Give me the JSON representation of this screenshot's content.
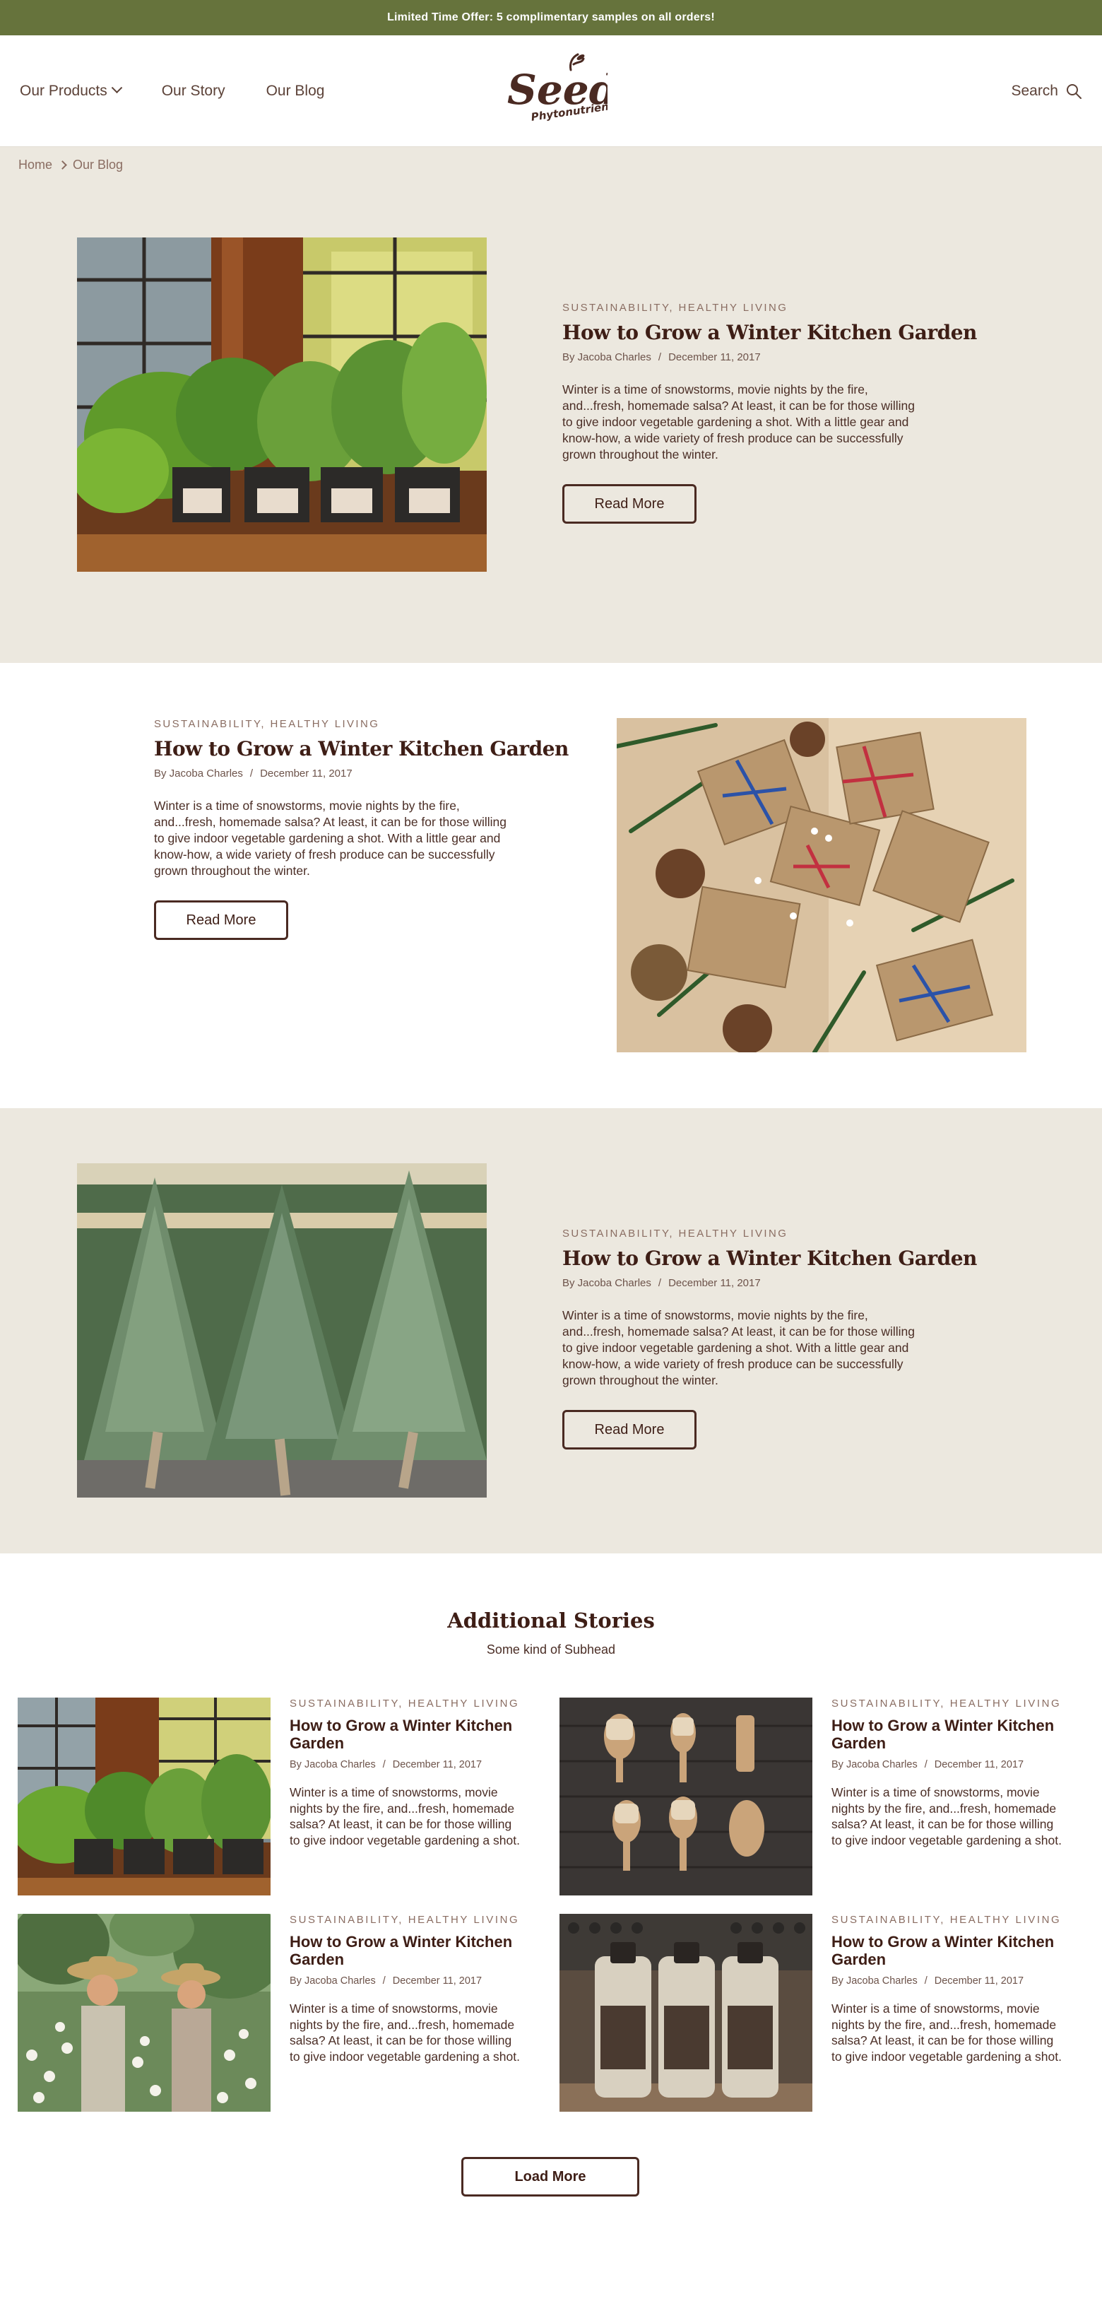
{
  "promo": {
    "text": "Limited Time Offer: 5 complimentary samples on all orders!"
  },
  "header": {
    "nav": [
      {
        "label": "Our Products",
        "has_dropdown": true
      },
      {
        "label": "Our Story"
      },
      {
        "label": "Our Blog"
      }
    ],
    "logo": {
      "main": "Seed",
      "sub": "Phytonutrients"
    },
    "search_label": "Search"
  },
  "breadcrumb": [
    "Home",
    "Our Blog"
  ],
  "features": [
    {
      "categories": "SUSTAINABILITY, HEALTHY LIVING",
      "title": "How to Grow a Winter Kitchen Garden",
      "author": "By Jacoba Charles",
      "separator": "/",
      "date": "December 11, 2017",
      "excerpt": "Winter is a time of snowstorms, movie nights by the fire, and...fresh, homemade salsa? At least, it can be for those willing to give indoor vegetable gardening a shot. With a little gear and know-how, a wide variety of fresh produce can be successfully grown throughout the winter.",
      "button": "Read More",
      "image": "herb-pots-window"
    },
    {
      "categories": "SUSTAINABILITY, HEALTHY LIVING",
      "title": "How to Grow a Winter Kitchen Garden",
      "author": "By Jacoba Charles",
      "separator": "/",
      "date": "December 11, 2017",
      "excerpt": "Winter is a time of snowstorms, movie nights by the fire, and...fresh, homemade salsa? At least, it can be for those willing to give indoor vegetable gardening a shot. With a little gear and know-how, a wide variety of fresh produce can be successfully grown throughout the winter.",
      "button": "Read More",
      "image": "wrapped-gifts-pine"
    },
    {
      "categories": "SUSTAINABILITY, HEALTHY LIVING",
      "title": "How to Grow a Winter Kitchen Garden",
      "author": "By Jacoba Charles",
      "separator": "/",
      "date": "December 11, 2017",
      "excerpt": "Winter is a time of snowstorms, movie nights by the fire, and...fresh, homemade salsa? At least, it can be for those willing to give indoor vegetable gardening a shot. With a little gear and know-how, a wide variety of fresh produce can be successfully grown throughout the winter.",
      "button": "Read More",
      "image": "christmas-trees"
    }
  ],
  "additional": {
    "title": "Additional Stories",
    "subhead": "Some kind of Subhead",
    "cards": [
      {
        "categories": "SUSTAINABILITY, HEALTHY LIVING",
        "title": "How to Grow a Winter Kitchen Garden",
        "author": "By Jacoba Charles",
        "separator": "/",
        "date": "December 11, 2017",
        "excerpt": "Winter is a time of snowstorms, movie nights by the fire, and...fresh, homemade salsa? At least, it can be for those willing to give indoor vegetable gardening a shot.",
        "image": "herb-pots-window"
      },
      {
        "categories": "SUSTAINABILITY, HEALTHY LIVING",
        "title": "How to Grow a Winter Kitchen Garden",
        "author": "By Jacoba Charles",
        "separator": "/",
        "date": "December 11, 2017",
        "excerpt": "Winter is a time of snowstorms, movie nights by the fire, and...fresh, homemade salsa? At least, it can be for those willing to give indoor vegetable gardening a shot.",
        "image": "wooden-brushes"
      },
      {
        "categories": "SUSTAINABILITY, HEALTHY LIVING",
        "title": "How to Grow a Winter Kitchen Garden",
        "author": "By Jacoba Charles",
        "separator": "/",
        "date": "December 11, 2017",
        "excerpt": "Winter is a time of snowstorms, movie nights by the fire, and...fresh, homemade salsa? At least, it can be for those willing to give indoor vegetable gardening a shot.",
        "image": "farmers-in-flower-field"
      },
      {
        "categories": "SUSTAINABILITY, HEALTHY LIVING",
        "title": "How to Grow a Winter Kitchen Garden",
        "author": "By Jacoba Charles",
        "separator": "/",
        "date": "December 11, 2017",
        "excerpt": "Winter is a time of snowstorms, movie nights by the fire, and...fresh, homemade salsa? At least, it can be for those willing to give indoor vegetable gardening a shot.",
        "image": "product-bottles"
      }
    ],
    "load_more": "Load More"
  },
  "colors": {
    "promo_bg": "#66733c",
    "beige_bg": "#ece8df",
    "heading": "#3e1e16",
    "meta": "#8a6d62"
  }
}
